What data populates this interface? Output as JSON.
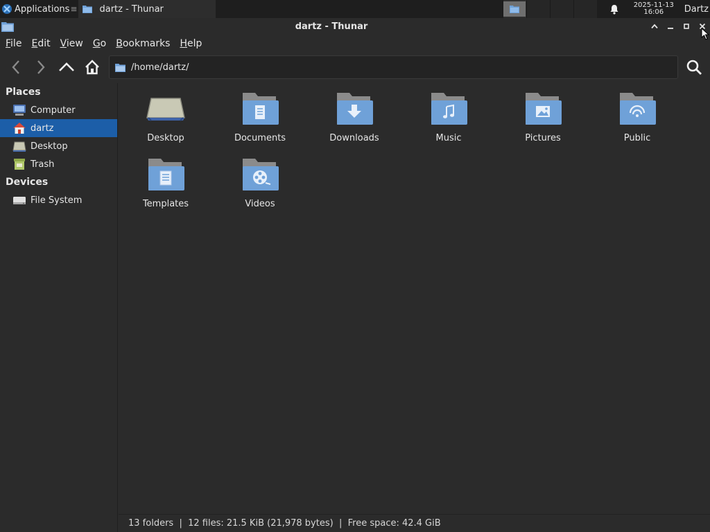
{
  "panel": {
    "applications_label": "Applications",
    "applications_sep": "≡",
    "task_label": "dartz - Thunar",
    "clock_date": "2025-11-13",
    "clock_time": "16:06",
    "user": "Dartz"
  },
  "window": {
    "title": "dartz - Thunar"
  },
  "menu": [
    "File",
    "Edit",
    "View",
    "Go",
    "Bookmarks",
    "Help"
  ],
  "toolbar": {
    "path": "/home/dartz/",
    "icons": [
      "back-icon",
      "forward-icon",
      "up-icon",
      "home-icon",
      "search-icon"
    ]
  },
  "sidebar": {
    "places_header": "Places",
    "places": [
      {
        "label": "Computer",
        "icon": "computer-icon"
      },
      {
        "label": "dartz",
        "icon": "home-icon",
        "selected": true
      },
      {
        "label": "Desktop",
        "icon": "desktop-icon"
      },
      {
        "label": "Trash",
        "icon": "trash-icon"
      }
    ],
    "devices_header": "Devices",
    "devices": [
      {
        "label": "File System",
        "icon": "drive-icon"
      }
    ]
  },
  "files": [
    {
      "name": "Desktop",
      "icon": "desktop-folder-icon"
    },
    {
      "name": "Documents",
      "icon": "documents-folder-icon"
    },
    {
      "name": "Downloads",
      "icon": "downloads-folder-icon"
    },
    {
      "name": "Music",
      "icon": "music-folder-icon"
    },
    {
      "name": "Pictures",
      "icon": "pictures-folder-icon"
    },
    {
      "name": "Public",
      "icon": "public-folder-icon"
    },
    {
      "name": "Templates",
      "icon": "templates-folder-icon"
    },
    {
      "name": "Videos",
      "icon": "videos-folder-icon"
    }
  ],
  "status": {
    "text": "13 folders  |  12 files: 21.5 KiB (21,978 bytes)  |  Free space: 42.4 GiB"
  },
  "colors": {
    "selection": "#1c5ea8",
    "folder_blue": "#6fa1d8",
    "background": "#2b2b2b"
  }
}
